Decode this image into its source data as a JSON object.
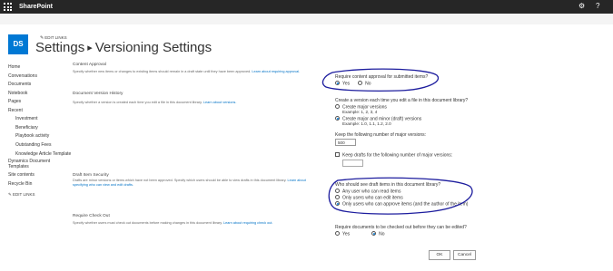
{
  "topbar": {
    "brand": "SharePoint",
    "gear_icon": "gear-icon",
    "help_icon": "question-icon",
    "help_glyph": "?"
  },
  "site": {
    "logo": "DS",
    "edit_links": "EDIT LINKS"
  },
  "page": {
    "title_settings": "Settings",
    "title_page": "Versioning Settings"
  },
  "nav": {
    "items": [
      {
        "label": "Home",
        "sub": false
      },
      {
        "label": "Conversations",
        "sub": false
      },
      {
        "label": "Documents",
        "sub": false
      },
      {
        "label": "Notebook",
        "sub": false
      },
      {
        "label": "Pages",
        "sub": false
      },
      {
        "label": "Recent",
        "sub": false
      },
      {
        "label": "Investment",
        "sub": true
      },
      {
        "label": "Beneficiary",
        "sub": true
      },
      {
        "label": "Playbook activity",
        "sub": true
      },
      {
        "label": "Outstanding Fees",
        "sub": true
      },
      {
        "label": "Knowledge Article Template",
        "sub": true
      },
      {
        "label": "Dynamics Document Templates",
        "sub": false
      },
      {
        "label": "Site contents",
        "sub": false
      },
      {
        "label": "Recycle Bin",
        "sub": false
      }
    ],
    "edit_links": "EDIT LINKS"
  },
  "sections": {
    "content_approval": {
      "title": "Content Approval",
      "desc": "Specify whether new items or changes to existing items should remain in a draft state until they have been approved.",
      "link": "Learn about requiring approval.",
      "question": "Require content approval for submitted items?",
      "options": [
        "Yes",
        "No"
      ],
      "selected": "Yes"
    },
    "version_history": {
      "title": "Document Version History",
      "desc": "Specify whether a version is created each time you edit a file in this document library.",
      "link": "Learn about versions.",
      "question": "Create a version each time you edit a file in this document library?",
      "opt_major": "Create major versions",
      "opt_major_example": "Example: 1, 2, 3, 4",
      "opt_minor": "Create major and minor (draft) versions",
      "opt_minor_example": "Example: 1.0, 1.1, 1.2, 2.0",
      "selected": "Create major and minor (draft) versions",
      "keep_major_label": "Keep the following number of major versions:",
      "keep_major_value": "500",
      "keep_drafts_label": "Keep drafts for the following number of major versions:",
      "keep_drafts_value": ""
    },
    "draft_security": {
      "title": "Draft Item Security",
      "desc": "Drafts are minor versions or items which have not been approved. Specify which users should be able to view drafts in this document library.",
      "link": "Learn about specifying who can view and edit drafts.",
      "question": "Who should see draft items in this document library?",
      "options": [
        "Any user who can read items",
        "Only users who can edit items",
        "Only users who can approve items (and the author of the item)"
      ],
      "selected": "Only users who can approve items (and the author of the item)"
    },
    "check_out": {
      "title": "Require Check Out",
      "desc": "Specify whether users must check out documents before making changes in this document library.",
      "link": "Learn about requiring check out.",
      "question": "Require documents to be checked out before they can be edited?",
      "options": [
        "Yes",
        "No"
      ],
      "selected": "No"
    }
  },
  "buttons": {
    "ok": "OK",
    "cancel": "Cancel"
  },
  "colors": {
    "topbar": "#262626",
    "accent": "#0078d4",
    "link": "#0072c6",
    "annotation": "#1d1d9e"
  }
}
